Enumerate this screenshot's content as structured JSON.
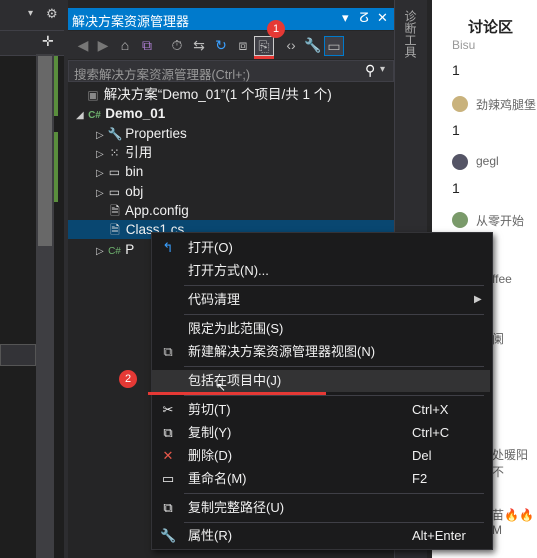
{
  "solution_explorer": {
    "title": "解决方案资源管理器",
    "search_placeholder": "搜索解决方案资源管理器(Ctrl+;)",
    "tree": {
      "solution": "解决方案“Demo_01”(1 个项目/共 1 个)",
      "project": "Demo_01",
      "items": [
        "Properties",
        "引用",
        "bin",
        "obj",
        "App.config",
        "Class1.cs",
        "P"
      ]
    }
  },
  "side_tab": "诊断工具",
  "discussion": {
    "title": "讨论区",
    "entries": [
      {
        "user": "Bisu",
        "text": "1"
      },
      {
        "user": "劲辣鸡腿堡",
        "text": "1"
      },
      {
        "user": "gegl",
        "text": "1"
      },
      {
        "user": "从零开始",
        "text": ""
      },
      {
        "user": "ffee",
        "text": ""
      },
      {
        "user": "阑",
        "text": ""
      },
      {
        "user": "处暖阳不",
        "text": ""
      },
      {
        "user": "苗🔥🔥M",
        "text": ""
      }
    ]
  },
  "context_menu": {
    "open": "打开(O)",
    "open_with": "打开方式(N)...",
    "code_cleanup": "代码清理",
    "scope_to_this": "限定为此范围(S)",
    "new_view": "新建解决方案资源管理器视图(N)",
    "include_in_project": "包括在项目中(J)",
    "cut": "剪切(T)",
    "cut_sc": "Ctrl+X",
    "copy": "复制(Y)",
    "copy_sc": "Ctrl+C",
    "delete": "删除(D)",
    "delete_sc": "Del",
    "rename": "重命名(M)",
    "rename_sc": "F2",
    "copy_full_path": "复制完整路径(U)",
    "properties": "属性(R)",
    "properties_sc": "Alt+Enter"
  },
  "annotations": {
    "badge1": "1",
    "badge2": "2"
  },
  "colors": {
    "accent": "#007acc",
    "annotation": "#e53935"
  }
}
